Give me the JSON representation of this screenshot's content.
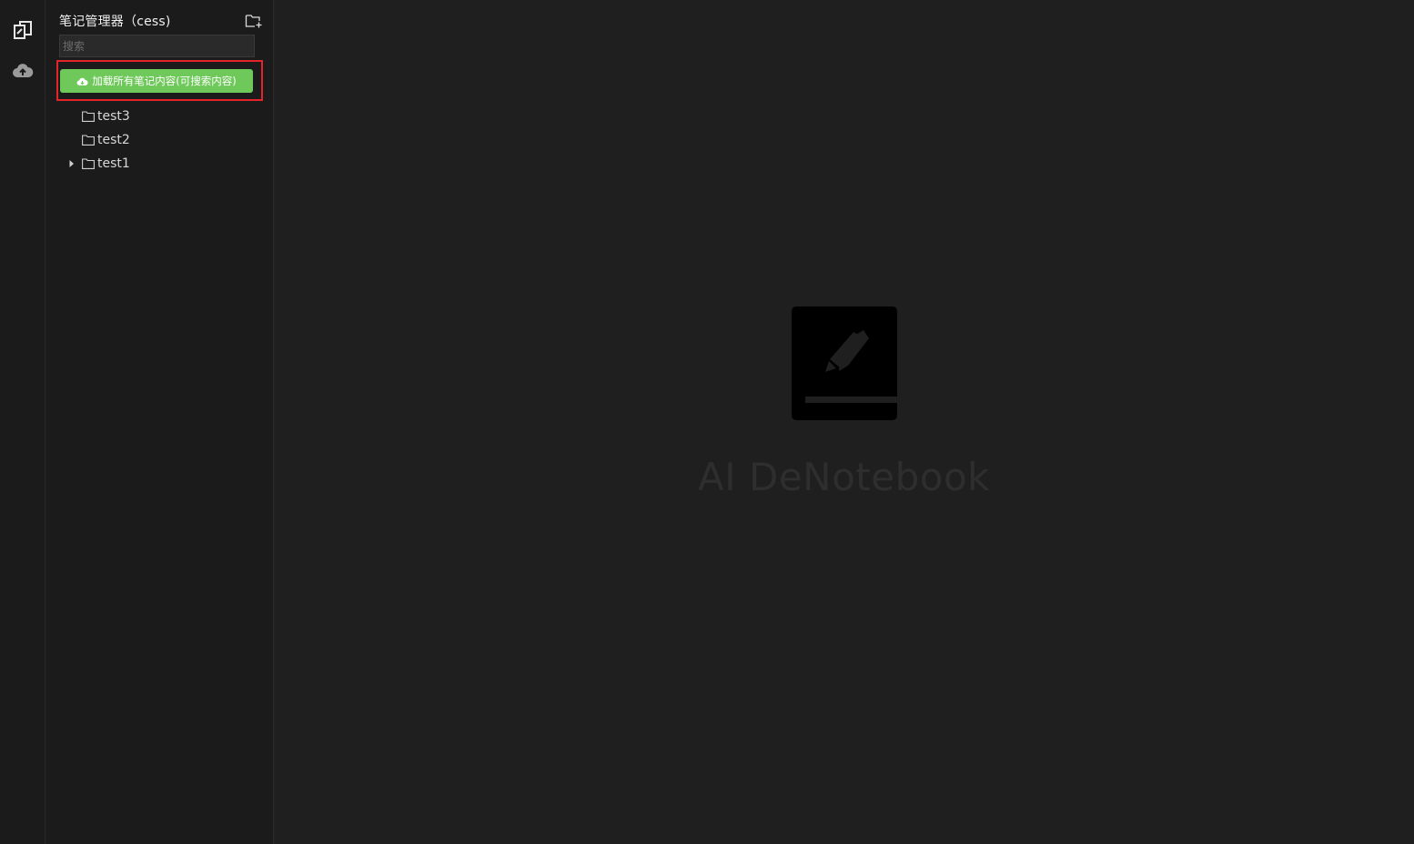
{
  "activity_bar": {
    "items": [
      {
        "icon": "notes-copy-icon"
      },
      {
        "icon": "cloud-upload-icon"
      }
    ]
  },
  "sidebar": {
    "title": "笔记管理器（cess)",
    "new_folder_icon": "new-folder-icon",
    "search_placeholder": "搜索",
    "search_value": "",
    "load_button_label": "加载所有笔记内容(可搜索内容)",
    "tree": [
      {
        "label": "test3",
        "expandable": false
      },
      {
        "label": "test2",
        "expandable": false
      },
      {
        "label": "test1",
        "expandable": true
      }
    ]
  },
  "main": {
    "app_name": "AI DeNotebook",
    "logo_icon": "notebook-edit-icon"
  },
  "colors": {
    "accent_green": "#6ec85a",
    "highlight_red": "#e3242b",
    "background": "#1f1f1f"
  }
}
